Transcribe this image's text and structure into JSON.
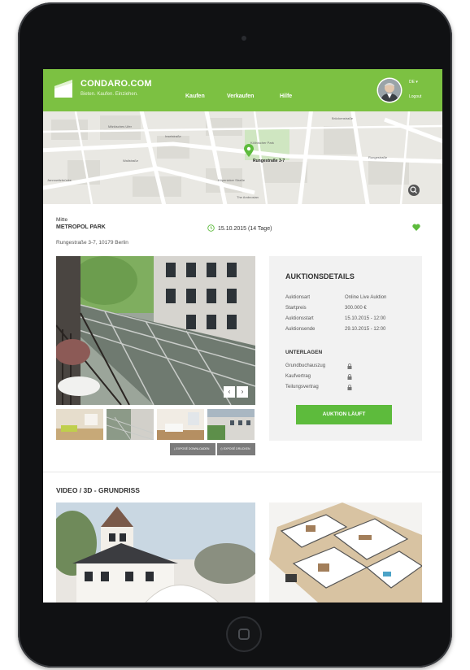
{
  "header": {
    "brand": "CONDARO.COM",
    "tagline": "Bieten. Kaufen. Einziehen.",
    "nav": [
      "Kaufen",
      "Verkaufen",
      "Hilfe"
    ],
    "language": "DE",
    "logout": "Logout"
  },
  "map": {
    "street_label": "Rungestraße 3-7",
    "labels": [
      "Märkisches Ufer",
      "Inselstraße",
      "Wallstraße",
      "Köpenicker Straße",
      "Köllnischer Park",
      "Brückenstraße",
      "Rungestraße",
      "The Ambrosian",
      "Jannowitzbrücke"
    ]
  },
  "listing": {
    "district": "Mitte",
    "title": "METROPOL PARK",
    "date": "15.10.2015 (14 Tage)",
    "address": "Rungestraße 3-7, 10179 Berlin"
  },
  "gallery": {
    "prev": "‹",
    "next": "›",
    "download_label": "EXPOSÉ DOWNLOADEN",
    "print_label": "EXPOSÉ DRUCKEN"
  },
  "details": {
    "title": "AUKTIONSDETAILS",
    "rows": [
      {
        "label": "Auktionsart",
        "value": "Online Live Auktion"
      },
      {
        "label": "Startpreis",
        "value": "300.000 €"
      },
      {
        "label": "Auktionsstart",
        "value": "15.10.2015 - 12:00"
      },
      {
        "label": "Auktionsende",
        "value": "29.10.2015 - 12:00"
      }
    ],
    "documents_title": "UNTERLAGEN",
    "documents": [
      "Grundbuchauszug",
      "Kaufvertrag",
      "Teilungsvertrag"
    ],
    "button": "AUKTION LÄUFT"
  },
  "media": {
    "title": "VIDEO / 3D - GRUNDRISS"
  },
  "colors": {
    "brand_green": "#7cc142",
    "button_green": "#5dbb3c",
    "device_frame": "#101113"
  }
}
